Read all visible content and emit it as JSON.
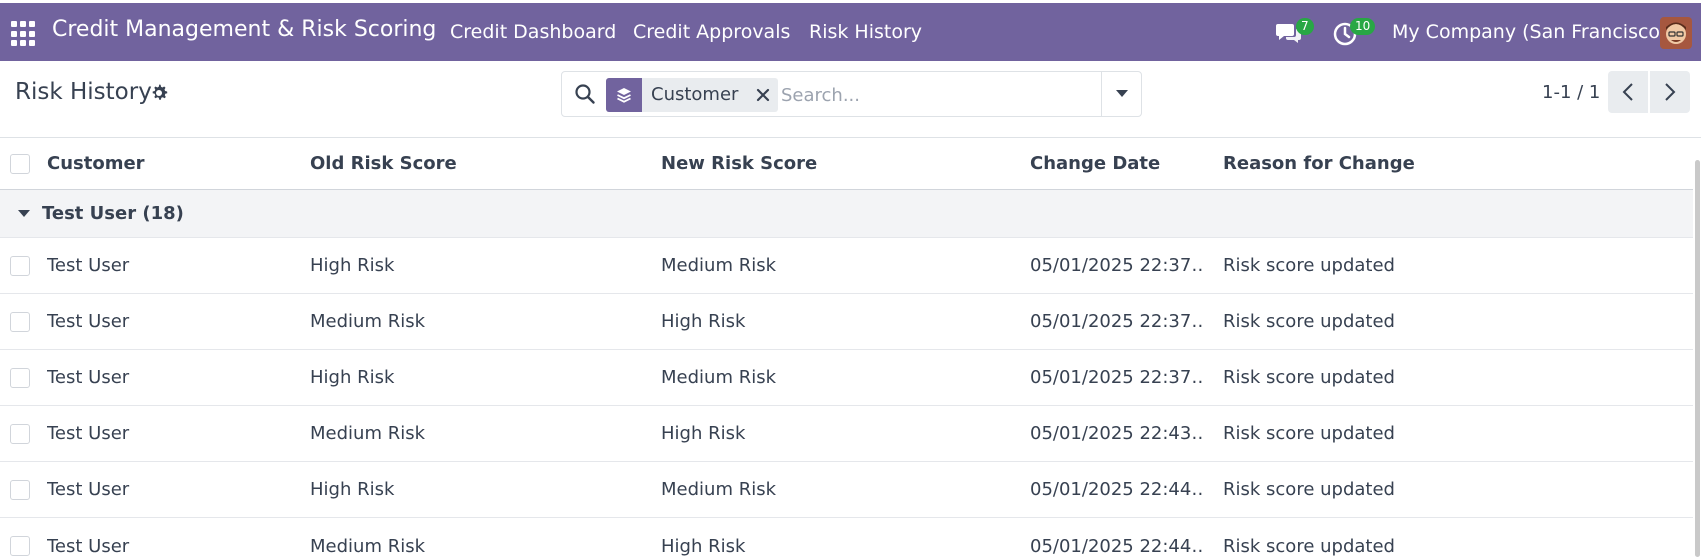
{
  "navbar": {
    "app_title": "Credit Management & Risk Scoring",
    "menu": [
      "Credit Dashboard",
      "Credit Approvals",
      "Risk History"
    ],
    "messages_badge": "7",
    "activities_badge": "10",
    "company": "My Company (San Francisco)",
    "brand_color": "#71639e"
  },
  "control": {
    "title": "Risk History",
    "facet_label": "Customer",
    "search_placeholder": "Search...",
    "pager": "1-1 / 1"
  },
  "table": {
    "columns": [
      "Customer",
      "Old Risk Score",
      "New Risk Score",
      "Change Date",
      "Reason for Change"
    ],
    "group_label": "Test User (18)",
    "rows": [
      {
        "customer": "Test User",
        "old": "High Risk",
        "new": "Medium Risk",
        "date": "05/01/2025 22:37…",
        "reason": "Risk score updated"
      },
      {
        "customer": "Test User",
        "old": "Medium Risk",
        "new": "High Risk",
        "date": "05/01/2025 22:37…",
        "reason": "Risk score updated"
      },
      {
        "customer": "Test User",
        "old": "High Risk",
        "new": "Medium Risk",
        "date": "05/01/2025 22:37…",
        "reason": "Risk score updated"
      },
      {
        "customer": "Test User",
        "old": "Medium Risk",
        "new": "High Risk",
        "date": "05/01/2025 22:43…",
        "reason": "Risk score updated"
      },
      {
        "customer": "Test User",
        "old": "High Risk",
        "new": "Medium Risk",
        "date": "05/01/2025 22:44…",
        "reason": "Risk score updated"
      },
      {
        "customer": "Test User",
        "old": "Medium Risk",
        "new": "High Risk",
        "date": "05/01/2025 22:44…",
        "reason": "Risk score updated"
      }
    ]
  }
}
